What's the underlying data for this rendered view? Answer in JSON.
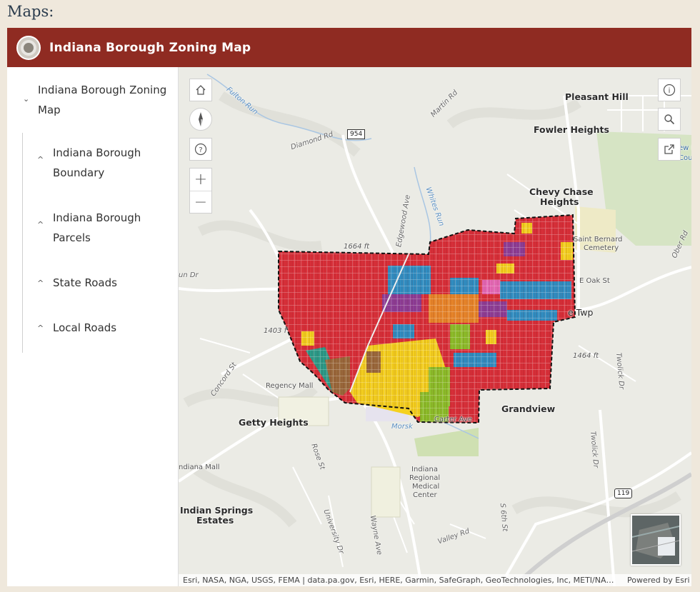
{
  "page": {
    "heading": "Maps:"
  },
  "app": {
    "title": "Indiana Borough Zoning Map",
    "header_color": "#8f2b22"
  },
  "layers": {
    "group_label": "Indiana Borough Zoning Map",
    "items": [
      {
        "label": "Indiana Borough Boundary"
      },
      {
        "label": "Indiana Borough Parcels"
      },
      {
        "label": "State Roads"
      },
      {
        "label": "Local Roads"
      }
    ]
  },
  "map": {
    "controls": {
      "home": "home-icon",
      "compass": "compass-icon",
      "help": "?",
      "zoom_in": "+",
      "zoom_out": "−",
      "info": "i",
      "search": "search-icon",
      "share": "share-icon"
    },
    "labels": {
      "pleasant_hill": "Pleasant Hill",
      "fowler_heights": "Fowler Heights",
      "chevy_chase_1": "Chevy Chase",
      "chevy_chase_2": "Heights",
      "saint_bernard_1": "Saint Bernard",
      "saint_bernard_2": "Cemetery",
      "e_oak_st": "E Oak St",
      "twp": "e Twp",
      "grandview": "Grandview",
      "getty_heights": "Getty Heights",
      "regency_mall": "Regency Mall",
      "indiana_regional_1": "Indiana",
      "indiana_regional_2": "Regional",
      "indiana_regional_3": "Medical",
      "indiana_regional_4": "Center",
      "indian_springs_1": "Indian Springs",
      "indian_springs_2": "Estates",
      "indiana_mall": "ndiana Mall",
      "fulton_run": "Fulton Run",
      "whites_run": "Whites Run",
      "diamond_rd": "Diamond Rd",
      "martin_rd": "Martin Rd",
      "edgewood_ave": "Edgewood Ave",
      "un_dr": "un Dr",
      "concord_st": "Concord St",
      "rose_st": "Rose St",
      "university_dr": "University Dr",
      "wayne_ave": "Wayne Ave",
      "s_6th_st": "S 6th St",
      "valley_rd": "Valley Rd",
      "twolick_dr_1": "Twolick Dr",
      "twolick_dr_2": "Twolick Dr",
      "oberl_rd": "Ober Rd",
      "elev_1664": "1664 ft",
      "elev_1403": "1403 f",
      "elev_1464": "1464 ft",
      "route_954": "954",
      "route_119": "119",
      "morsk": "Morsk",
      "carter": "Carter Ave",
      "new_l": "ew L",
      "cou": "Cou"
    },
    "attribution": "Esri, NASA, NGA, USGS, FEMA | data.pa.gov, Esri, HERE, Garmin, SafeGraph, GeoTechnologies, Inc, METI/NASA, USGS, Bureau of Land Management, EPA, NPS, USDA",
    "powered_by": "Powered by Esri",
    "zoning_colors": {
      "residential": "#d9303a",
      "commercial": "#2f8fc4",
      "institutional": "#f5d11f",
      "mixed": "#8e3f98",
      "office": "#e8862a",
      "industrial": "#9a6a3c",
      "park": "#8cbf2a",
      "special": "#2a9d8a",
      "other": "#e66ab8"
    }
  }
}
